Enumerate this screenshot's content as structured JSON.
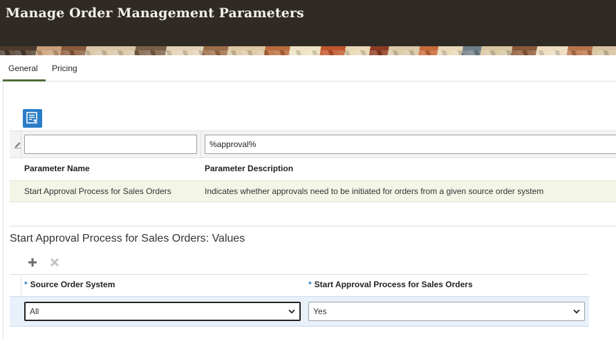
{
  "page": {
    "title": "Manage Order Management Parameters"
  },
  "tabs": [
    {
      "label": "General",
      "selected": true
    },
    {
      "label": "Pricing",
      "selected": false
    }
  ],
  "toolbar": {
    "filter_icon": "query-by-example-icon"
  },
  "filters": {
    "parameter_name": "",
    "parameter_description": "%approval%"
  },
  "parameters_table": {
    "columns": [
      "Parameter Name",
      "Parameter Description"
    ],
    "rows": [
      {
        "name": "Start Approval Process for Sales Orders",
        "description": "Indicates whether approvals need to be initiated for orders from a given source order system"
      }
    ]
  },
  "values_section": {
    "title": "Start Approval Process for Sales Orders: Values",
    "add_icon": "plus-icon",
    "delete_icon": "x-icon",
    "required_marker": "*",
    "columns": [
      "Source Order System",
      "Start Approval Process for Sales Orders"
    ],
    "rows": [
      {
        "source_order_system": "All",
        "start_approval": "Yes"
      }
    ]
  },
  "colors": {
    "header_bg": "#302a25",
    "accent_blue": "#2b7dc8",
    "tab_underline": "#4f6c3a",
    "selected_row": "#f3f5e6",
    "edit_row": "#e8f1fa"
  }
}
